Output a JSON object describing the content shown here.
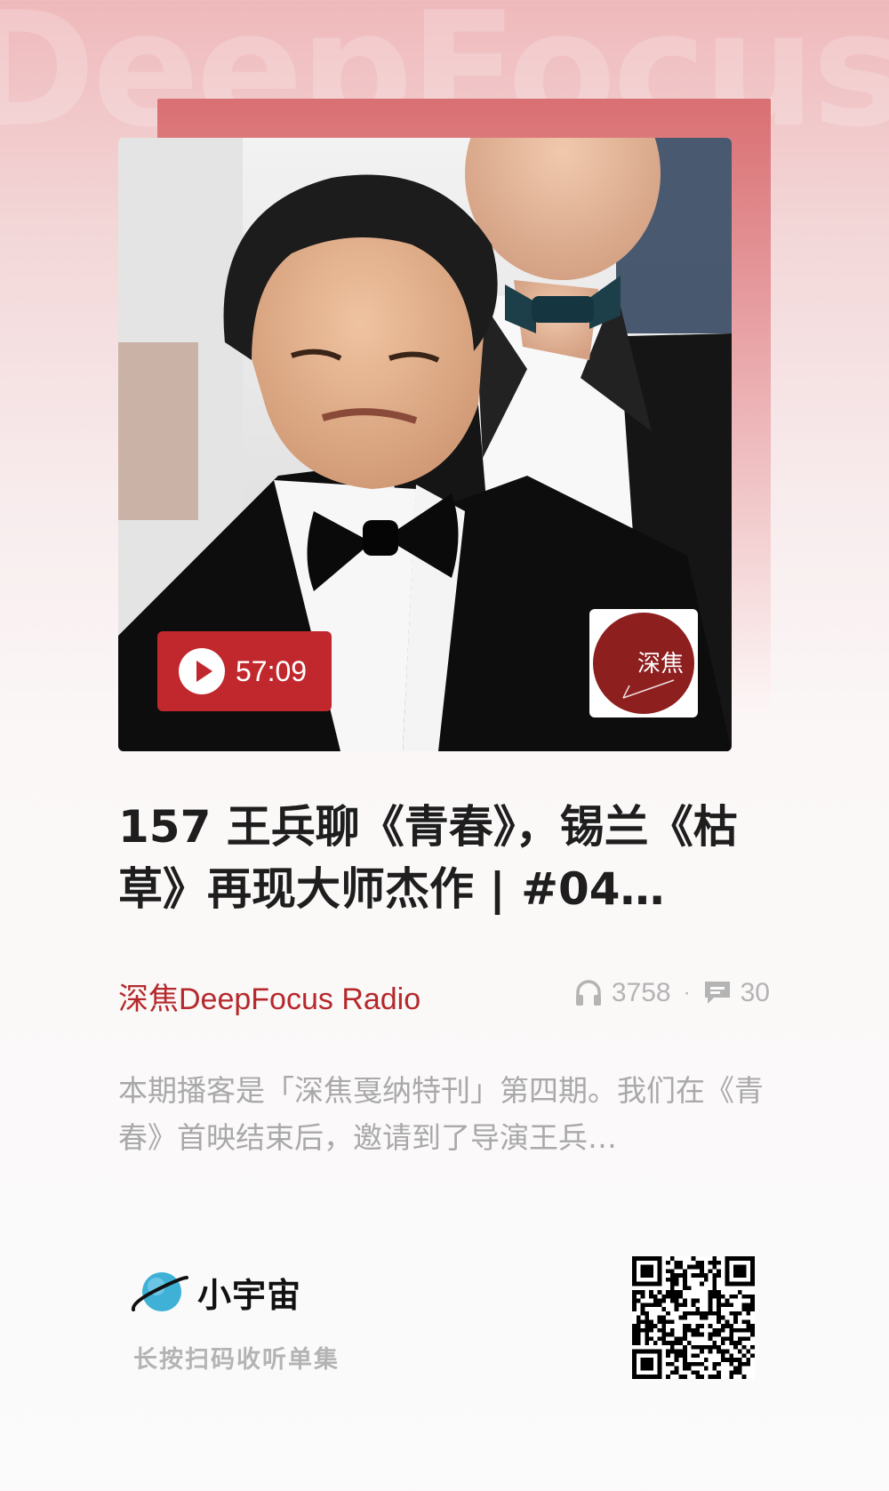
{
  "background_text": "DeepFocus R",
  "cover": {
    "duration": "57:09",
    "logo_text": "深焦"
  },
  "episode": {
    "title": "157 王兵聊《青春》，锡兰《枯草》再现大师杰作 | #04…",
    "podcast_name": "深焦DeepFocus Radio",
    "plays": "3758",
    "separator": "·",
    "comments": "30",
    "description": "本期播客是「深焦戛纳特刊」第四期。我们在《青春》首映结束后，邀请到了导演王兵…"
  },
  "footer": {
    "brand_name": "小宇宙",
    "hint": "长按扫码收听单集"
  },
  "colors": {
    "accent": "#c0282d",
    "podcast_name": "#b5292c",
    "logo_circle": "#8e1f1f"
  }
}
